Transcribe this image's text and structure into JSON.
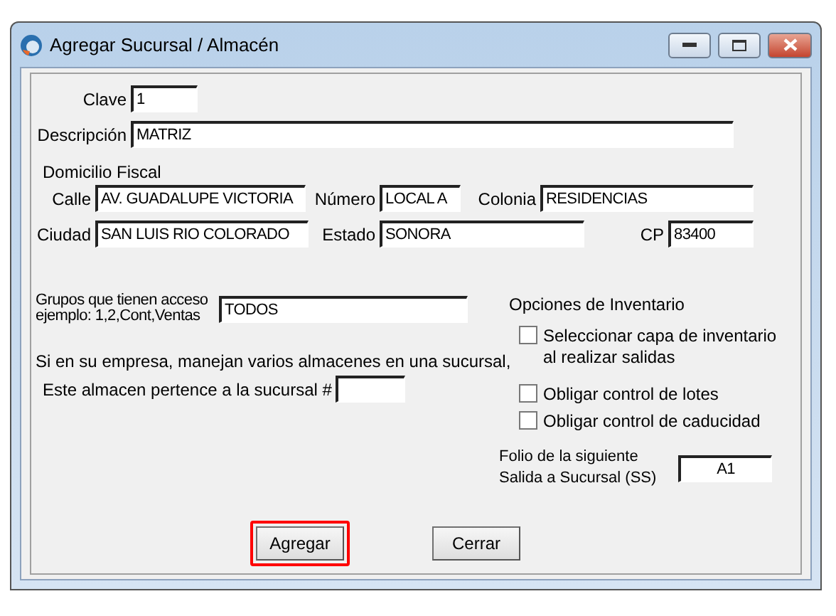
{
  "window": {
    "title": "Agregar Sucursal / Almacén"
  },
  "clave": {
    "label": "Clave",
    "value": "1"
  },
  "descripcion": {
    "label": "Descripción",
    "value": "MATRIZ"
  },
  "domicilio": {
    "title": "Domicilio Fiscal",
    "row_1": [
      {
        "label": "Calle",
        "value": "AV. GUADALUPE VICTORIA"
      },
      {
        "label": "Número",
        "value": "LOCAL A"
      },
      {
        "label": "Colonia",
        "value": "RESIDENCIAS"
      }
    ],
    "row_2": [
      {
        "label": "Ciudad",
        "value": "SAN LUIS RIO COLORADO"
      },
      {
        "label": "Estado",
        "value": "SONORA"
      },
      {
        "label": "CP",
        "value": "83400"
      }
    ]
  },
  "grupos": {
    "label_lines": [
      "Grupos que tienen acceso",
      "ejemplo: 1,2,Cont,Ventas"
    ],
    "value": "TODOS"
  },
  "almacen_note": "Si en su empresa, manejan varios almacenes en una sucursal,",
  "sucursal": {
    "label": "Este almacen pertence a la sucursal #"
  },
  "inventario": {
    "title": "Opciones de Inventario",
    "options": [
      {
        "label_lines": [
          "Seleccionar capa de inventario",
          "al realizar salidas"
        ],
        "checked": false
      },
      {
        "label_lines": [
          "Obligar control de lotes"
        ],
        "checked": false
      },
      {
        "label_lines": [
          "Obligar control de caducidad"
        ],
        "checked": false
      }
    ]
  },
  "folio": {
    "label_lines": [
      "Folio de la siguiente",
      "Salida a Sucursal (SS)"
    ],
    "value": "A1"
  },
  "buttons": [
    {
      "label": "Agregar",
      "highlighted": true
    },
    {
      "label": "Cerrar",
      "highlighted": false
    }
  ]
}
